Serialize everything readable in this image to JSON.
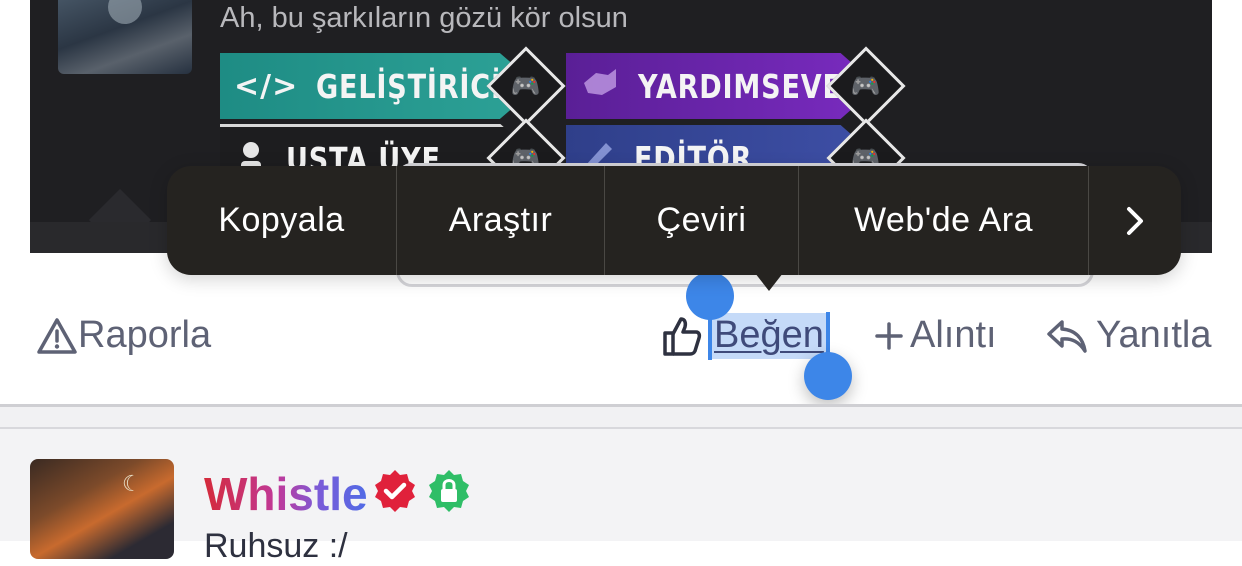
{
  "signature": {
    "text": "Ah, bu şarkıların gözü kör olsun",
    "badges": [
      {
        "label": "GELİŞTİRİCİ",
        "symbol": "</>",
        "color": "#239a8f"
      },
      {
        "label": "YARDIMSEVER",
        "symbol": "",
        "color": "#6a25ad"
      },
      {
        "label": "USTA ÜYE",
        "symbol": "",
        "color": "#1d1d1f"
      },
      {
        "label": "EDİTÖR",
        "symbol": "",
        "color": "#3a4a9c"
      }
    ]
  },
  "context_menu": {
    "items": [
      "Kopyala",
      "Araştır",
      "Çeviri",
      "Web'de Ara"
    ],
    "more_icon": "›"
  },
  "actions": {
    "report": "Raporla",
    "like": "Beğen",
    "quote": "Alıntı",
    "reply": "Yanıtla"
  },
  "next_post": {
    "username": "Whistle",
    "subtitle": "Ruhsuz :/"
  },
  "colors": {
    "selection": "#3d86e8",
    "menu_bg": "#252320",
    "action_text": "#5e6275"
  }
}
